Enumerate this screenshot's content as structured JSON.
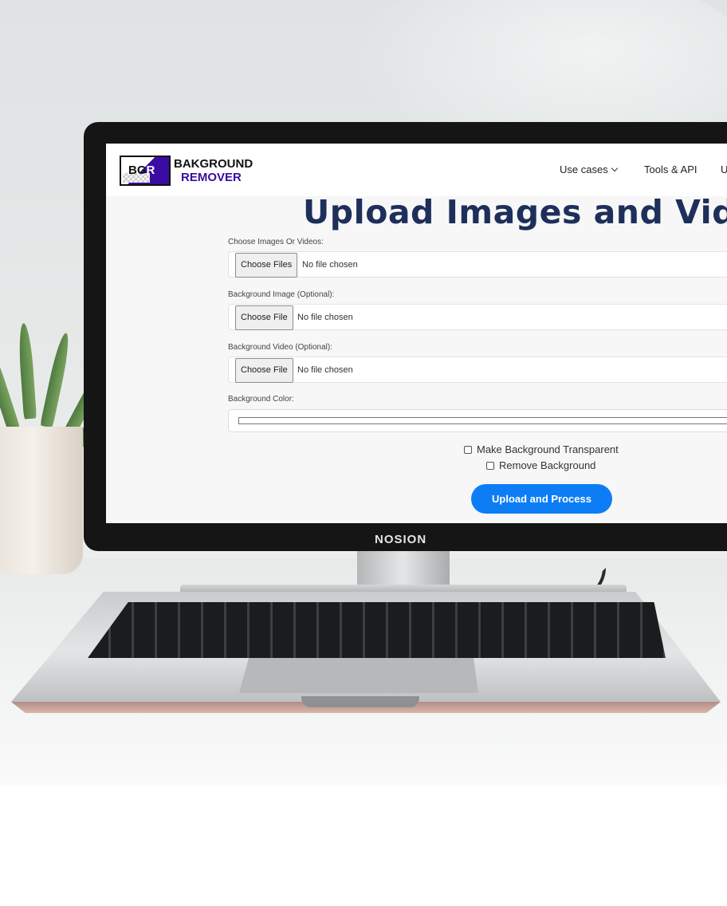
{
  "monitor": {
    "brand": "NOSION"
  },
  "site": {
    "brand_line1": "BAKGROUND",
    "brand_line2": "REMOVER",
    "logo_text_a": "BG",
    "logo_text_b": "R",
    "nav": [
      {
        "label": "Use cases"
      },
      {
        "label": "Tools & API"
      },
      {
        "label": "U"
      }
    ],
    "title": "Upload Images and Vide"
  },
  "form": {
    "media": {
      "label": "Choose Images Or Videos:",
      "button": "Choose Files",
      "status": "No file chosen"
    },
    "bg_image": {
      "label": "Background Image (Optional):",
      "button": "Choose File",
      "status": "No file chosen"
    },
    "bg_video": {
      "label": "Background Video (Optional):",
      "button": "Choose File",
      "status": "No file chosen"
    },
    "bg_color": {
      "label": "Background Color:",
      "value": "#ffffff"
    },
    "transparent": {
      "label": "Make Background Transparent",
      "checked": false
    },
    "remove": {
      "label": "Remove Background",
      "checked": false
    },
    "submit": "Upload and Process"
  },
  "colors": {
    "title": "#1d2f5a",
    "brand_purple": "#3a0ca3",
    "submit_bg": "#0d7df5"
  }
}
